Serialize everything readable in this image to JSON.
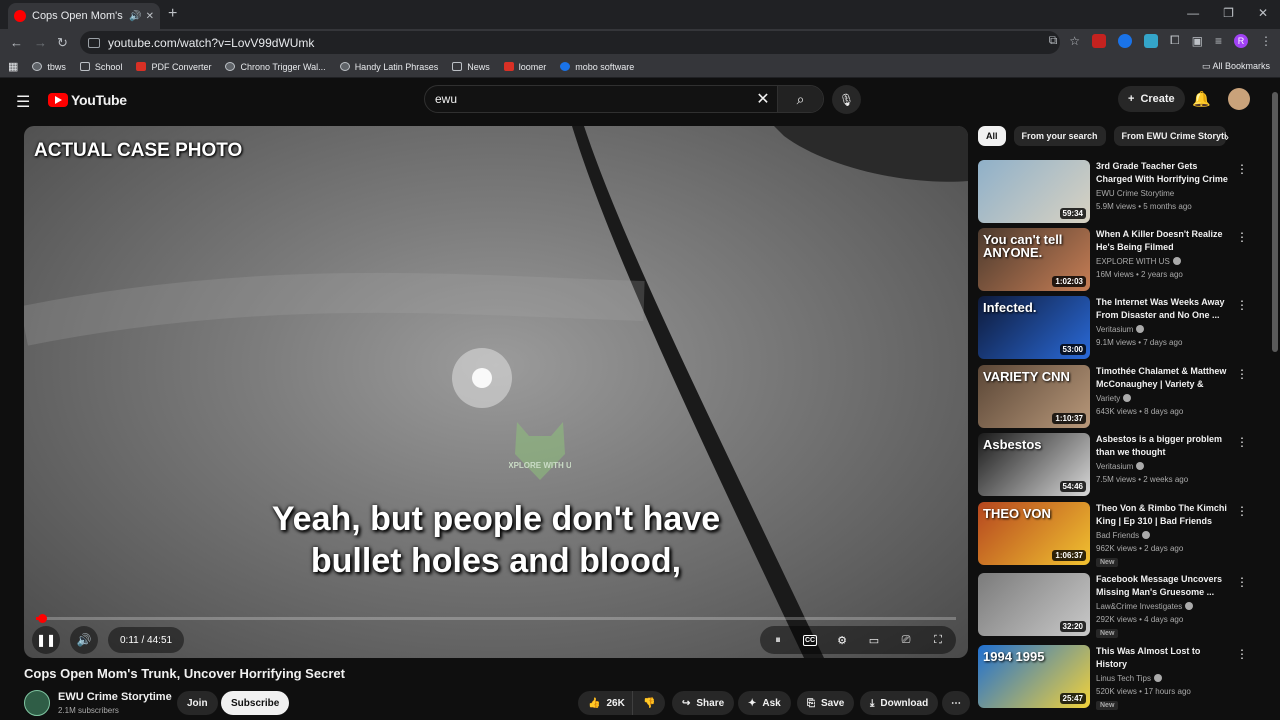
{
  "browser": {
    "tab_title": "Cops Open Mom's Trunk, Uncover Horrifying Secret",
    "url": "youtube.com/watch?v=LovV99dWUmk",
    "bookmarks": [
      {
        "label": "tbws",
        "kind": "circle"
      },
      {
        "label": "School",
        "kind": "folder"
      },
      {
        "label": "PDF Converter",
        "kind": "red"
      },
      {
        "label": "Chrono Trigger Wal...",
        "kind": "circle"
      },
      {
        "label": "Handy Latin Phrases",
        "kind": "circle"
      },
      {
        "label": "News",
        "kind": "folder"
      },
      {
        "label": "loomer",
        "kind": "red"
      },
      {
        "label": "mobo software",
        "kind": "blue"
      }
    ],
    "all_bookmarks": "All Bookmarks",
    "profile_initial": "R"
  },
  "header": {
    "logo_text": "YouTube",
    "search_value": "ewu",
    "create_label": "Create"
  },
  "player": {
    "overlay_label": "ACTUAL CASE PHOTO",
    "subtitle_line1": "Yeah, but people don't have",
    "subtitle_line2": "bullet holes and blood,",
    "watermark_text": "EXPLORE WITH US",
    "current_time": "0:11",
    "duration": "44:51",
    "time_display": "0:11 / 44:51",
    "progress_fraction": 0.004
  },
  "video": {
    "title": "Cops Open Mom's Trunk, Uncover Horrifying Secret",
    "channel": "EWU Crime Storytime",
    "subscribers": "2.1M subscribers",
    "join_label": "Join",
    "subscribe_label": "Subscribe",
    "likes": "26K",
    "share_label": "Share",
    "ask_label": "Ask",
    "save_label": "Save",
    "download_label": "Download"
  },
  "chips": [
    "All",
    "From your search",
    "From EWU Crime Storytime"
  ],
  "recommendations": [
    {
      "title": "3rd Grade Teacher Gets Charged With Horrifying Crime",
      "channel": "EWU Crime Storytime",
      "verified": false,
      "meta": "5.9M views • 5 months ago",
      "duration": "59:34",
      "thumb_text": "",
      "new": false,
      "colors": [
        "#8fb0c9",
        "#d8d2c2"
      ]
    },
    {
      "title": "When A Killer Doesn't Realize He's Being Filmed",
      "channel": "EXPLORE WITH US",
      "verified": true,
      "meta": "16M views • 2 years ago",
      "duration": "1:02:03",
      "thumb_text": "You can't tell ANYONE.",
      "new": false,
      "colors": [
        "#4b3a2e",
        "#c77e55"
      ]
    },
    {
      "title": "The Internet Was Weeks Away From Disaster and No One ...",
      "channel": "Veritasium",
      "verified": true,
      "meta": "9.1M views • 7 days ago",
      "duration": "53:00",
      "thumb_text": "Infected.",
      "new": false,
      "colors": [
        "#0e1a3a",
        "#2a6ad8"
      ]
    },
    {
      "title": "Timothée Chalamet & Matthew McConaughey | Variety & CNN...",
      "channel": "Variety",
      "verified": true,
      "meta": "643K views • 8 days ago",
      "duration": "1:10:37",
      "thumb_text": "VARIETY CNN",
      "new": false,
      "colors": [
        "#5a4636",
        "#b8987a"
      ]
    },
    {
      "title": "Asbestos is a bigger problem than we thought",
      "channel": "Veritasium",
      "verified": true,
      "meta": "7.5M views • 2 weeks ago",
      "duration": "54:46",
      "thumb_text": "Asbestos",
      "new": false,
      "colors": [
        "#1a1a1a",
        "#d9d9d9"
      ]
    },
    {
      "title": "Theo Von & Rimbo The Kimchi King | Ep 310 | Bad Friends",
      "channel": "Bad Friends",
      "verified": true,
      "meta": "962K views • 2 days ago",
      "duration": "1:06:37",
      "thumb_text": "THEO VON",
      "new": true,
      "colors": [
        "#b5461f",
        "#f1c230"
      ]
    },
    {
      "title": "Facebook Message Uncovers Missing Man's Gruesome ...",
      "channel": "Law&Crime Investigates",
      "verified": true,
      "meta": "292K views • 4 days ago",
      "duration": "32:20",
      "thumb_text": "",
      "new": true,
      "colors": [
        "#7b7b7b",
        "#c9c9c9"
      ]
    },
    {
      "title": "This Was Almost Lost to History",
      "channel": "Linus Tech Tips",
      "verified": true,
      "meta": "520K views • 17 hours ago",
      "duration": "25:47",
      "thumb_text": "1994 1995",
      "new": true,
      "colors": [
        "#1f6fd1",
        "#f2d23a"
      ]
    }
  ]
}
